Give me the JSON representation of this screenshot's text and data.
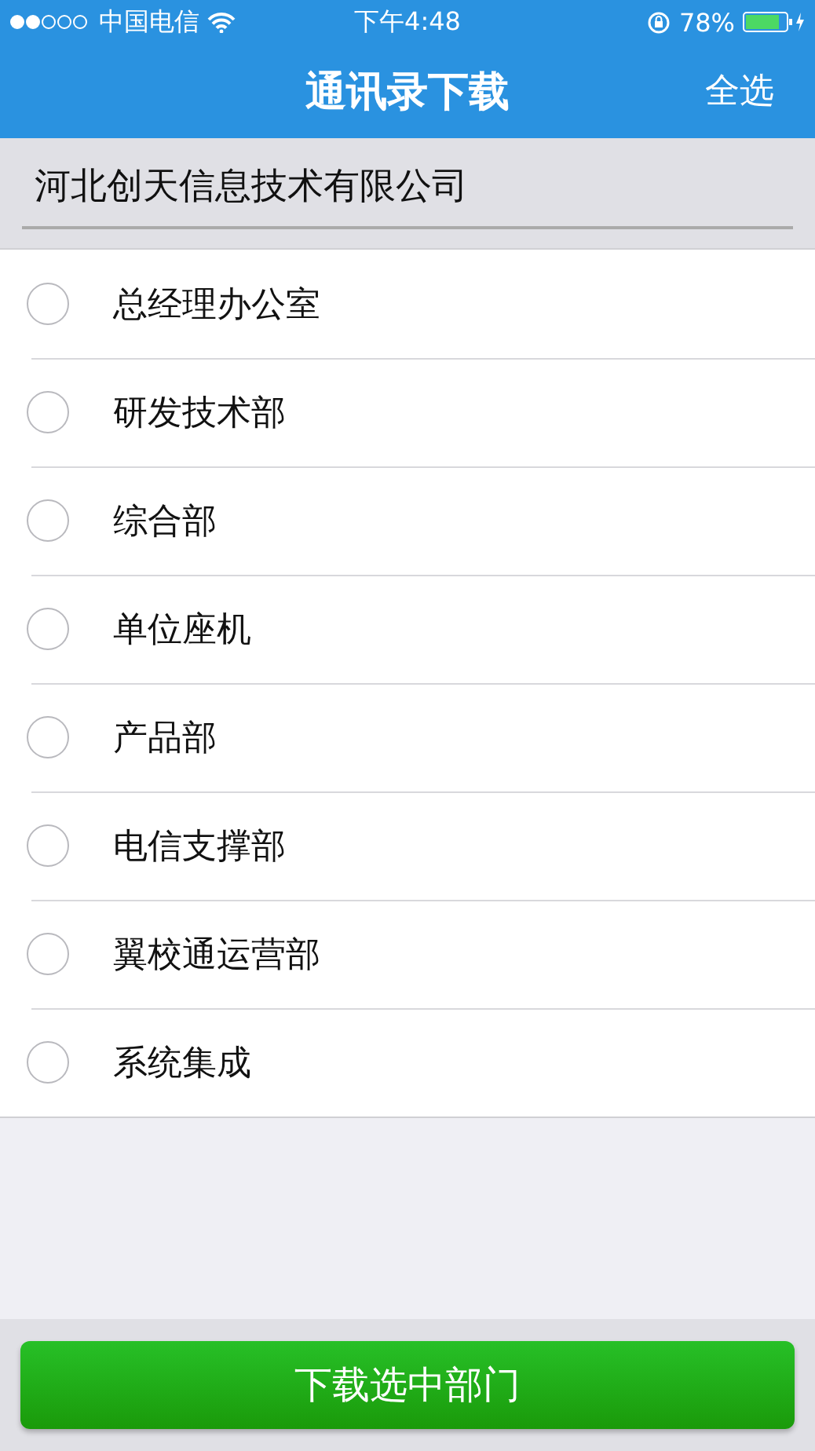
{
  "status_bar": {
    "carrier": "中国电信",
    "time": "下午4:48",
    "battery_percent": "78%"
  },
  "nav": {
    "title": "通讯录下载",
    "action": "全选"
  },
  "company": {
    "value": "河北创天信息技术有限公司"
  },
  "departments": [
    {
      "name": "总经理办公室",
      "selected": false
    },
    {
      "name": "研发技术部",
      "selected": false
    },
    {
      "name": "综合部",
      "selected": false
    },
    {
      "name": "单位座机",
      "selected": false
    },
    {
      "name": "产品部",
      "selected": false
    },
    {
      "name": "电信支撑部",
      "selected": false
    },
    {
      "name": "翼校通运营部",
      "selected": false
    },
    {
      "name": "系统集成",
      "selected": false
    }
  ],
  "download_button": "下载选中部门"
}
